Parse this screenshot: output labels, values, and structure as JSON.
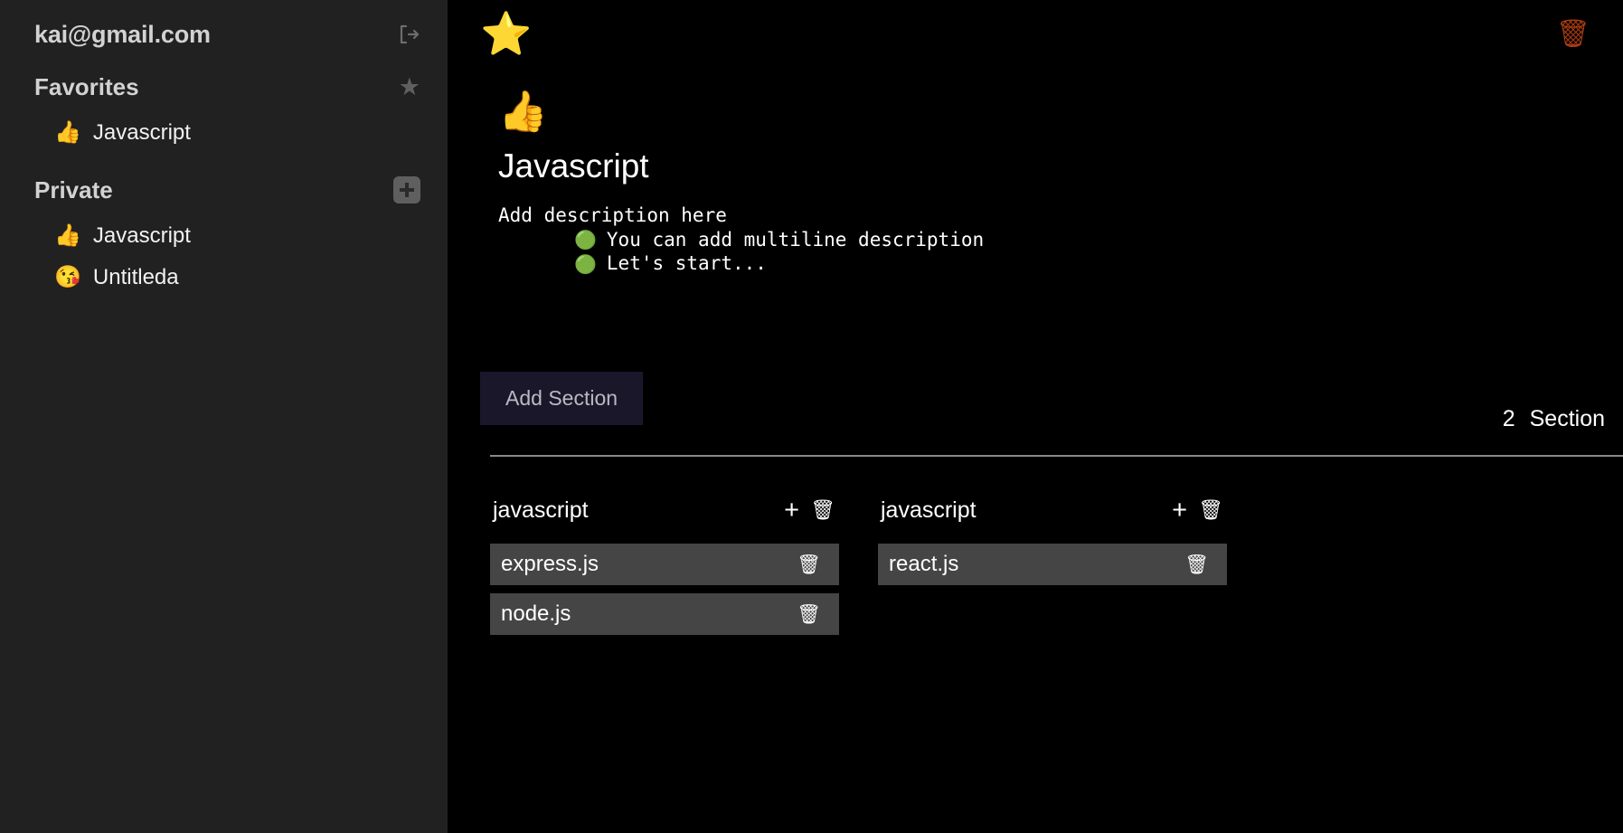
{
  "colors": {
    "sidebar_bg": "#212121",
    "main_bg": "#000000",
    "accent_button": "#1b172a",
    "task_bg": "#454545",
    "trash_orange": "#a83a12",
    "bullet_green": "#12b412",
    "star_yellow": "#ffe800"
  },
  "sidebar": {
    "account_email": "kai@gmail.com",
    "logout_icon": "logout-icon",
    "favorites": {
      "label": "Favorites",
      "icon": "star-icon",
      "items": [
        {
          "emoji": "👍",
          "label": "Javascript"
        }
      ]
    },
    "private": {
      "label": "Private",
      "icon": "plus-square-icon",
      "items": [
        {
          "emoji": "👍",
          "label": "Javascript"
        },
        {
          "emoji": "😘",
          "label": "Untitleda"
        }
      ]
    }
  },
  "main": {
    "favorite_star_icon": "⭐",
    "delete_page_icon": "🗑",
    "document": {
      "emoji": "👍",
      "title": "Javascript",
      "description_first_line": "Add description here",
      "description_bullets": [
        {
          "bullet": "🟢",
          "text": "You can add multiline description"
        },
        {
          "bullet": "🟢",
          "text": "Let's start..."
        }
      ]
    },
    "add_section_label": "Add Section",
    "section_count_number": "2",
    "section_count_label": "Section",
    "sections": [
      {
        "title": "javascript",
        "add_icon": "+",
        "delete_icon": "🗑",
        "tasks": [
          {
            "label": "express.js",
            "delete_icon": "🗑"
          },
          {
            "label": "node.js",
            "delete_icon": "🗑"
          }
        ]
      },
      {
        "title": "javascript",
        "add_icon": "+",
        "delete_icon": "🗑",
        "tasks": [
          {
            "label": "react.js",
            "delete_icon": "🗑"
          }
        ]
      }
    ]
  }
}
